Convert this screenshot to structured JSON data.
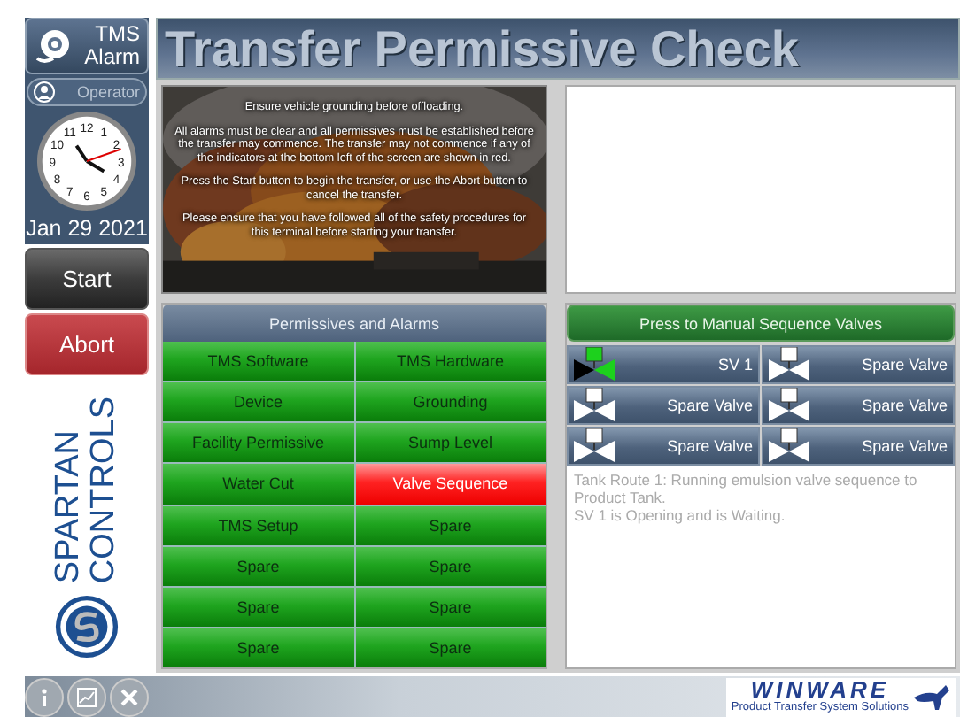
{
  "sidebar": {
    "alarm_button": {
      "line_1": "TMS",
      "line_2": "Alarm"
    },
    "user": {
      "name": "Operator"
    },
    "clock": {
      "numerals": [
        "11",
        "12",
        "1",
        "10",
        "2",
        "9",
        "3",
        "8",
        "4",
        "7",
        "6",
        "5"
      ]
    },
    "date": "Jan 29 2021",
    "buttons": [
      {
        "label": "Start",
        "kind": "start"
      },
      {
        "label": "Abort",
        "kind": "abort"
      }
    ],
    "logo": {
      "line_1": "SPARTAN",
      "line_2": "CONTROLS"
    }
  },
  "title": "Transfer Permissive Check",
  "instructions": {
    "paragraphs": [
      "Ensure vehicle grounding before offloading.",
      "All alarms must be clear and all permissives must be established before the transfer may commence.  The transfer may not commence if any of the indicators at the bottom left of the screen are shown in red.",
      "Press the Start button to begin the transfer, or use the Abort button to cancel the transfer.",
      "Please ensure that you have followed all of the safety procedures for this terminal before starting your transfer."
    ]
  },
  "permissives": {
    "header": "Permissives and Alarms",
    "items": [
      {
        "label": "TMS Software",
        "alarm": false
      },
      {
        "label": "TMS Hardware",
        "alarm": false
      },
      {
        "label": "Device",
        "alarm": false
      },
      {
        "label": "Grounding",
        "alarm": false
      },
      {
        "label": "Facility Permissive",
        "alarm": false
      },
      {
        "label": "Sump Level",
        "alarm": false
      },
      {
        "label": "Water Cut",
        "alarm": false
      },
      {
        "label": "Valve Sequence",
        "alarm": true
      },
      {
        "label": "TMS Setup",
        "alarm": false
      },
      {
        "label": "Spare",
        "alarm": false
      },
      {
        "label": "Spare",
        "alarm": false
      },
      {
        "label": "Spare",
        "alarm": false
      },
      {
        "label": "Spare",
        "alarm": false
      },
      {
        "label": "Spare",
        "alarm": false
      },
      {
        "label": "Spare",
        "alarm": false
      },
      {
        "label": "Spare",
        "alarm": false
      }
    ]
  },
  "valves": {
    "header": "Press to Manual Sequence Valves",
    "items": [
      {
        "label": "SV 1",
        "active": true
      },
      {
        "label": "Spare Valve",
        "active": false
      },
      {
        "label": "Spare Valve",
        "active": false
      },
      {
        "label": "Spare Valve",
        "active": false
      },
      {
        "label": "Spare Valve",
        "active": false
      },
      {
        "label": "Spare Valve",
        "active": false
      }
    ],
    "status_lines": [
      "Tank Route 1: Running emulsion valve sequence to Product Tank.",
      "SV 1 is Opening and is Waiting."
    ]
  },
  "footer": {
    "brand": "WINWARE",
    "tagline": "Product Transfer System Solutions"
  }
}
